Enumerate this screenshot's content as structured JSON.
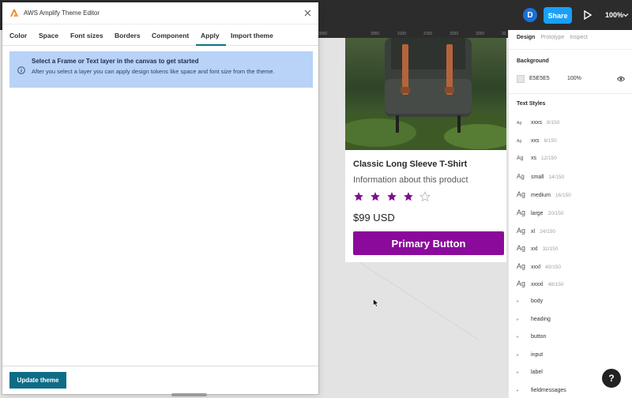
{
  "toolbar": {
    "avatar_initial": "D",
    "share_label": "Share",
    "zoom_label": "100%"
  },
  "ruler": {
    "ticks": [
      "3000",
      "3050",
      "3100",
      "3150",
      "3200",
      "3250",
      "33"
    ]
  },
  "plugin": {
    "title": "AWS Amplify Theme Editor",
    "tabs": [
      "Color",
      "Space",
      "Font sizes",
      "Borders",
      "Component",
      "Apply",
      "Import theme"
    ],
    "active_tab": "Apply",
    "alert": {
      "title": "Select a Frame or Text layer in the canvas to get started",
      "body": "After you select a layer you can apply design tokens like space and font size from the theme."
    },
    "update_button": "Update theme",
    "accent_color": "#0e6c87",
    "alert_color": "#b8d2f8"
  },
  "product_card": {
    "title": "Classic Long Sleeve T-Shirt",
    "info": "Information about this product",
    "rating": 4,
    "rating_max": 5,
    "price": "$99 USD",
    "button_label": "Primary Button",
    "button_color": "#8b0a9b"
  },
  "design_panel": {
    "tabs": [
      "Design",
      "Prototype",
      "Inspect"
    ],
    "active_tab": "Design",
    "background": {
      "heading": "Background",
      "hex": "E5E5E5",
      "opacity": "100%"
    },
    "text_styles_heading": "Text Styles",
    "sized_styles": [
      {
        "name": "xxxs",
        "meta": "8/150"
      },
      {
        "name": "xxs",
        "meta": "8/150"
      },
      {
        "name": "xs",
        "meta": "12/150"
      },
      {
        "name": "small",
        "meta": "14/150"
      },
      {
        "name": "medium",
        "meta": "16/150"
      },
      {
        "name": "large",
        "meta": "20/150"
      },
      {
        "name": "xl",
        "meta": "24/150"
      },
      {
        "name": "xxl",
        "meta": "32/150"
      },
      {
        "name": "xxxl",
        "meta": "40/150"
      },
      {
        "name": "xxxxl",
        "meta": "48/150"
      }
    ],
    "style_groups": [
      "body",
      "heading",
      "button",
      "input",
      "label",
      "fieldmessages"
    ],
    "help_label": "?"
  }
}
